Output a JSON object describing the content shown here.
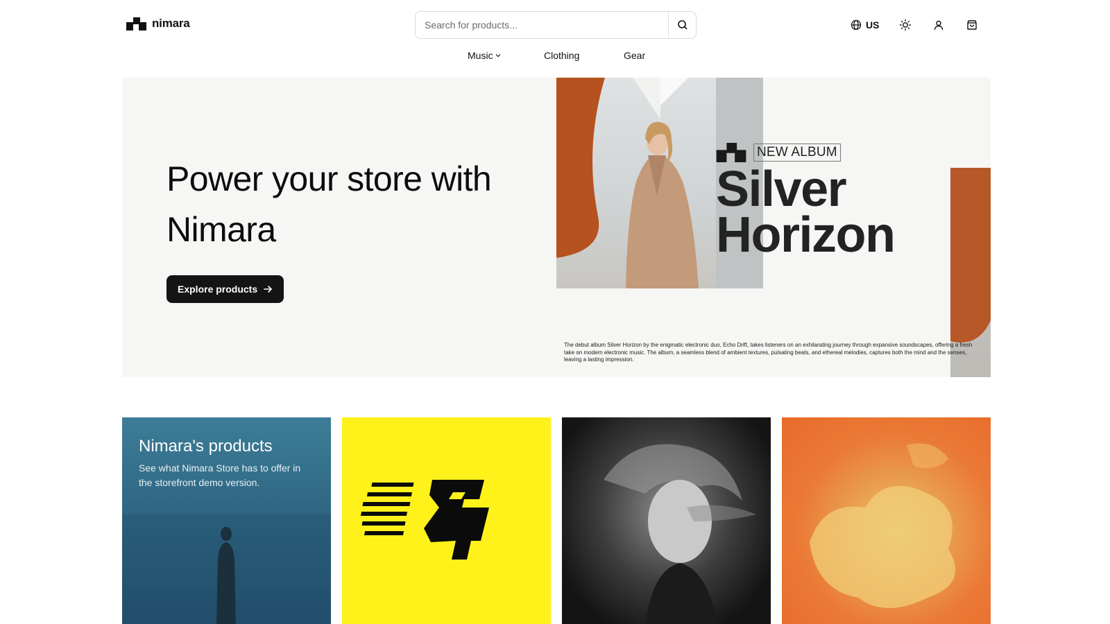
{
  "brand": {
    "name": "nimara"
  },
  "search": {
    "placeholder": "Search for products..."
  },
  "header": {
    "locale": "US"
  },
  "nav": {
    "items": [
      "Music",
      "Clothing",
      "Gear"
    ]
  },
  "hero": {
    "title": "Power your store with Nimara",
    "cta": "Explore products",
    "album": {
      "tag": "NEW ALBUM",
      "name_line1": "Silver",
      "name_line2": "Horizon",
      "description": "The debut album Silver Horizon by the enigmatic electronic duo, Echo Drift, takes listeners on an exhilarating journey through expansive soundscapes, offering a fresh take on modern electronic music. The album, a seamless blend of ambient textures, pulsating beats, and ethereal melodies, captures both the mind and the senses, leaving a lasting impression."
    }
  },
  "cards": [
    {
      "title": "Nimara's products",
      "text": "See what Nimara Store has to offer in the storefront demo version."
    }
  ],
  "colors": {
    "accent_dark": "#141414",
    "hero_bg": "#f6f6f4",
    "card_yellow": "#fff21a",
    "rust": "#b5521f"
  }
}
